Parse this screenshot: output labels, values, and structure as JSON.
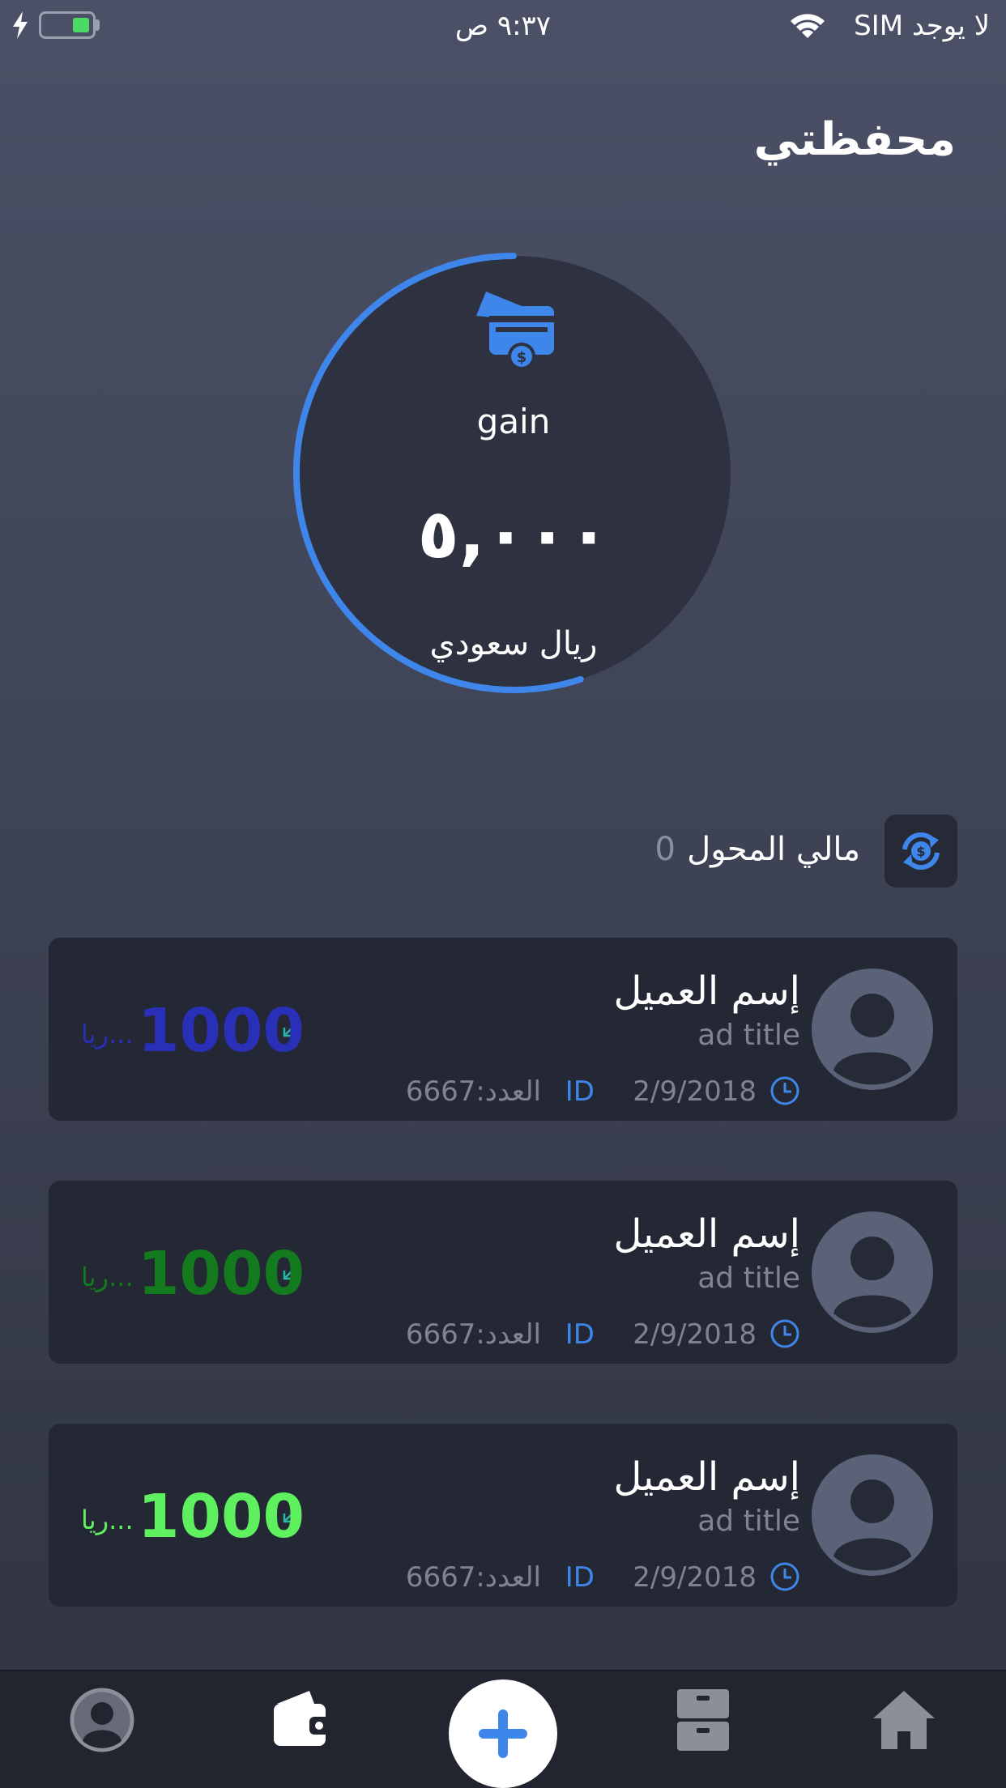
{
  "status_bar": {
    "carrier": "لا يوجد SIM",
    "time": "٩:٣٧ ص"
  },
  "page": {
    "title": "محفظتي"
  },
  "wallet": {
    "label": "gain",
    "amount": "٥,٠٠٠",
    "currency": "ريال سعودي",
    "progress_fraction": 0.55,
    "accent_color": "#3e86ea"
  },
  "transfer": {
    "label": "مالي المحول",
    "value": "0"
  },
  "transactions": [
    {
      "client_name": "إسم العميل",
      "ad_title": "ad title",
      "date": "2/9/2018",
      "id_tag": "ID",
      "count": "العدد:6667",
      "amount": "1000",
      "unit": "ريا...",
      "amount_color": "#2a2fb8"
    },
    {
      "client_name": "إسم العميل",
      "ad_title": "ad title",
      "date": "2/9/2018",
      "id_tag": "ID",
      "count": "العدد:6667",
      "amount": "1000",
      "unit": "ريا...",
      "amount_color": "#137a1d"
    },
    {
      "client_name": "إسم العميل",
      "ad_title": "ad title",
      "date": "2/9/2018",
      "id_tag": "ID",
      "count": "العدد:6667",
      "amount": "1000",
      "unit": "ريا...",
      "amount_color": "#5ef05e"
    }
  ],
  "tabbar": {
    "items": [
      {
        "icon": "profile-icon"
      },
      {
        "icon": "wallet-icon"
      },
      {
        "icon": "add-icon"
      },
      {
        "icon": "archive-icon"
      },
      {
        "icon": "home-icon"
      }
    ]
  }
}
